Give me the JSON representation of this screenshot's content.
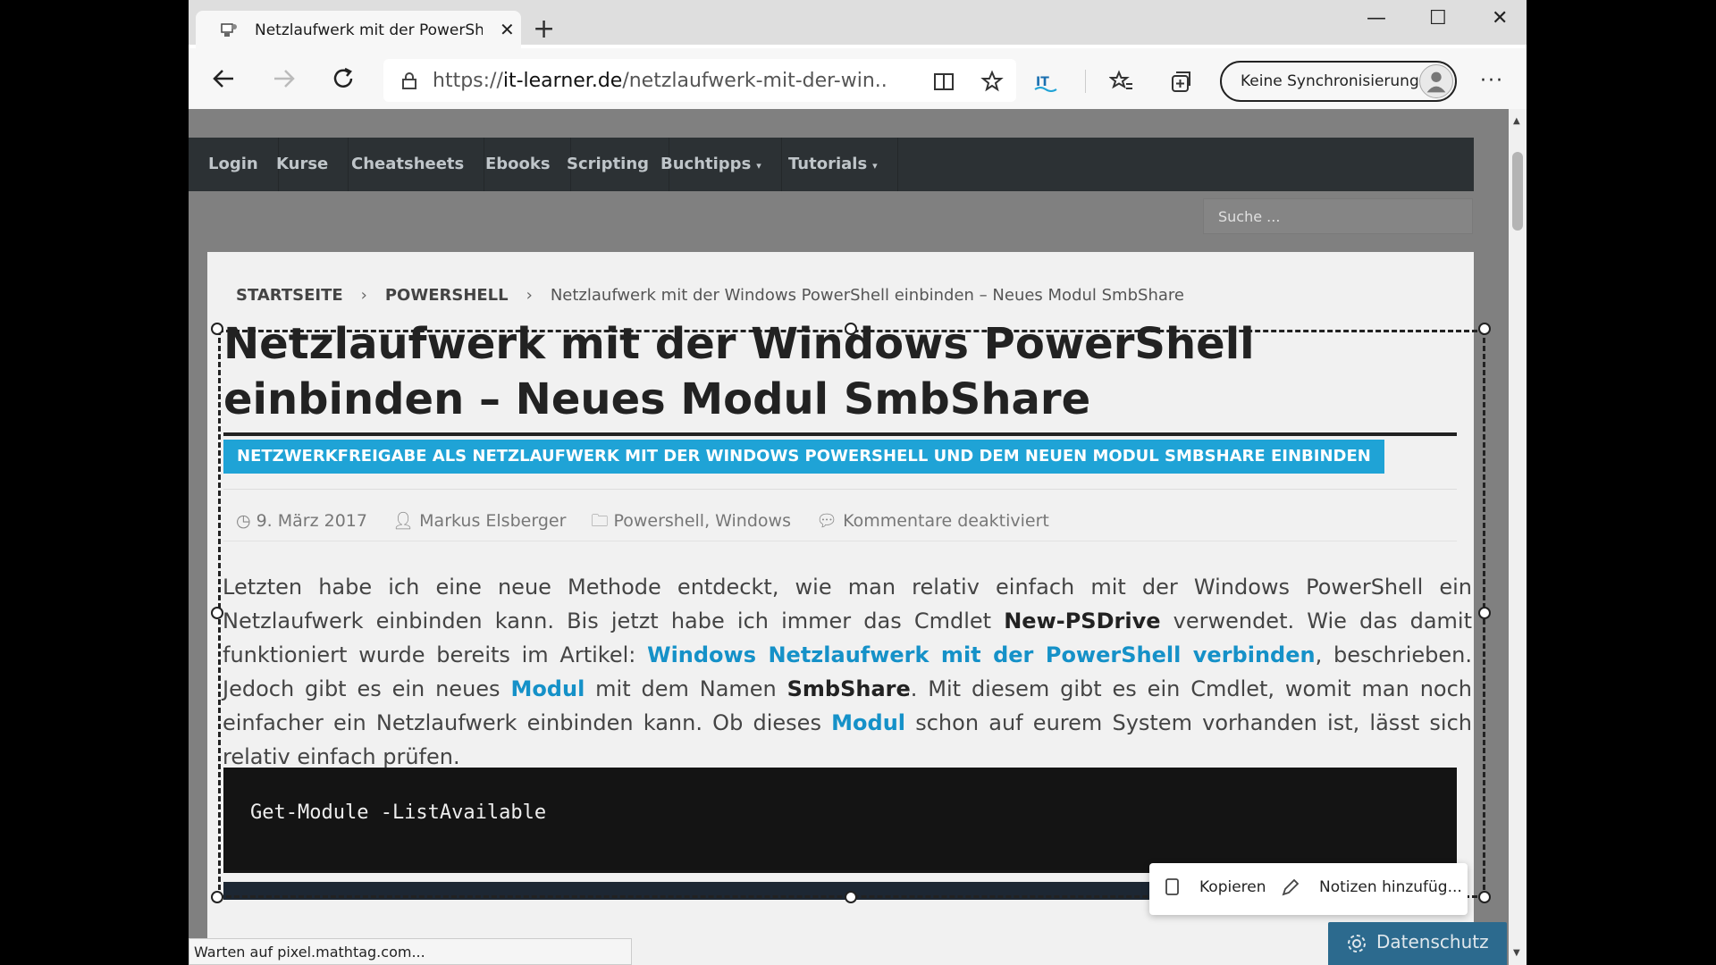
{
  "browser": {
    "tab_title": "Netzlaufwerk mit der PowerShell",
    "url_scheme": "https://",
    "url_host": "it-learner.de",
    "url_path": "/netzlaufwerk-mit-der-win...",
    "sync_label": "Keine Synchronisierung",
    "status_text": "Warten auf pixel.mathtag.com..."
  },
  "nav": {
    "items": [
      "Login",
      "Kurse",
      "Cheatsheets",
      "Ebooks",
      "Scripting",
      "Buchtipps",
      "Tutorials"
    ]
  },
  "search": {
    "placeholder": "Suche ..."
  },
  "breadcrumb": {
    "home": "STARTSEITE",
    "category": "POWERSHELL",
    "current": "Netzlaufwerk mit der Windows PowerShell einbinden – Neues Modul SmbShare"
  },
  "article": {
    "title": "Netzlaufwerk mit der Windows PowerShell einbinden – Neues Modul SmbShare",
    "subtitle": "NETZWERKFREIGABE ALS NETZLAUFWERK MIT DER WINDOWS POWERSHELL UND DEM NEUEN MODUL SMBSHARE EINBINDEN",
    "date": "9. März 2017",
    "author": "Markus Elsberger",
    "categories": "Powershell, Windows",
    "comments": "Kommentare deaktiviert",
    "p1": "Letzten habe ich eine neue Methode entdeckt, wie man relativ einfach mit der Windows PowerShell ein Netzlaufwerk einbinden kann. Bis jetzt habe ich immer das Cmdlet ",
    "cmdlet1": "New-PSDrive",
    "p2": " verwendet. Wie das damit funktioniert wurde bereits im Artikel: ",
    "link1": "Windows Netzlaufwerk mit der PowerShell verbinden",
    "p3": ", beschrieben. Jedoch gibt es ein neues ",
    "link2": "Modul",
    "p4": " mit dem Namen ",
    "module": "SmbShare",
    "p5": ". Mit diesem gibt es ein Cmdlet, womit man noch einfacher ein Netzlaufwerk einbinden kann. Ob dieses ",
    "link3": "Modul",
    "p6": " schon auf eurem System vorhanden ist, lässt sich relativ einfach prüfen.",
    "code": "Get-Module -ListAvailable"
  },
  "context_menu": {
    "copy": "Kopieren",
    "notes": "Notizen hinzufüg..."
  },
  "privacy": {
    "label": "Datenschutz"
  },
  "colors": {
    "nav_bg": "#2c3134",
    "accent": "#1fa3d6",
    "link": "#1591c8",
    "code_bg": "#141414"
  }
}
